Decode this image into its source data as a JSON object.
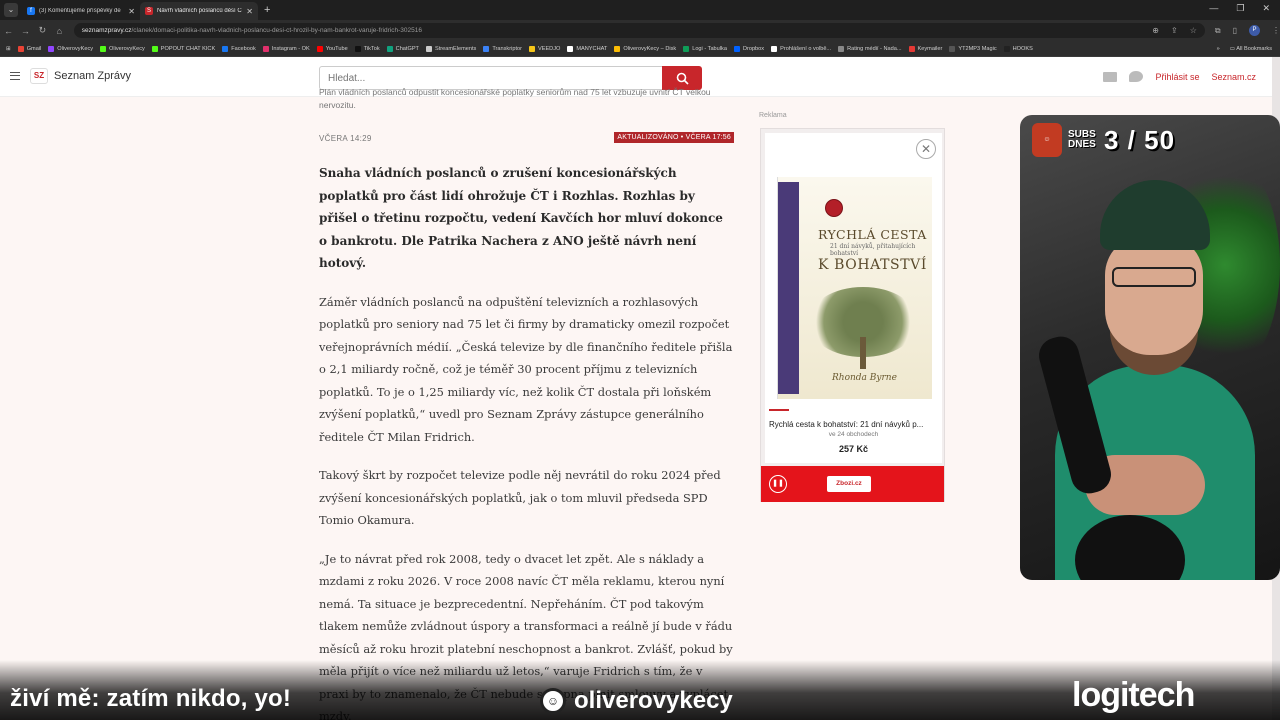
{
  "browser": {
    "tabs": [
      {
        "title": "(3) Komentujeme příspěvky de",
        "icon": "facebook-icon",
        "color": "#1877f2",
        "active": false
      },
      {
        "title": "Návrh vládních poslanců děsí Č",
        "icon": "sz-icon",
        "color": "#c8262b",
        "active": true
      }
    ],
    "url_domain": "seznamzpravy.cz",
    "url_path": "/clanek/domaci-politika-navrh-vladnich-poslancu-desi-ct-hrozil-by-nam-bankrot-varuje-fridrich-302516",
    "bookmarks": [
      {
        "label": "Gmail",
        "color": "#ea4335"
      },
      {
        "label": "OliverovyKecy",
        "color": "#9146ff"
      },
      {
        "label": "OliverovyKecy",
        "color": "#53fc18"
      },
      {
        "label": "POPOUT CHAT KICK",
        "color": "#53fc18"
      },
      {
        "label": "Facebook",
        "color": "#1877f2"
      },
      {
        "label": "Instagram - OK",
        "color": "#e1306c"
      },
      {
        "label": "YouTube",
        "color": "#ff0000"
      },
      {
        "label": "TikTok",
        "color": "#111111"
      },
      {
        "label": "ChatGPT",
        "color": "#10a37f"
      },
      {
        "label": "StreamElements",
        "color": "#cccccc"
      },
      {
        "label": "Transkriptor",
        "color": "#3b82f6"
      },
      {
        "label": "VEEDJO",
        "color": "#f5c518"
      },
      {
        "label": "MANYCHAT",
        "color": "#ffffff"
      },
      {
        "label": "OliverovyKecy – Disk",
        "color": "#fbbc04"
      },
      {
        "label": "Logi - Tabulka",
        "color": "#0f9d58"
      },
      {
        "label": "Dropbox",
        "color": "#0061ff"
      },
      {
        "label": "Prohlášení o volbě...",
        "color": "#ffffff"
      },
      {
        "label": "Rating médií - Nada...",
        "color": "#888888"
      },
      {
        "label": "Keymailer",
        "color": "#e53935"
      },
      {
        "label": "YT2MP3 Magic",
        "color": "#555555"
      },
      {
        "label": "HOOKS",
        "color": "#222222"
      }
    ],
    "all_bookmarks": "All Bookmarks",
    "profile_initial": "P"
  },
  "site": {
    "logo_mark": "SZ",
    "logo_text": "Seznam Zprávy",
    "search_placeholder": "Hledat...",
    "login": "Přihlásit se",
    "portal": "Seznam.cz",
    "accent": "#c8262b"
  },
  "article": {
    "caption": "Plán vládních poslanců odpustit koncesionářské poplatky seniorům nad 75 let vzbuzuje uvnitř ČT velkou nervozitu.",
    "date": "VČERA 14:29",
    "updated": "AKTUALIZOVÁNO • VČERA 17:56",
    "lead": "Snaha vládních poslanců o zrušení koncesionářských poplatků pro část lidí ohrožuje ČT i Rozhlas. Rozhlas by přišel o třetinu rozpočtu, vedení Kavčích hor mluví dokonce o bankrotu. Dle Patrika Nachera z ANO ještě návrh není hotový.",
    "paragraphs": [
      "Záměr vládních poslanců na odpuštění televizních a rozhlasových poplatků pro seniory nad 75 let či firmy by dramaticky omezil rozpočet veřejnoprávních médií. „Česká televize by dle finančního ředitele přišla o 2,1 miliardy ročně, což je téměř 30 procent příjmu z televizních poplatků. To je o 1,25 miliardy víc, než kolik ČT dostala při loňském zvýšení poplatků,“ uvedl pro Seznam Zprávy zástupce generálního ředitele ČT Milan Fridrich.",
      "Takový škrt by rozpočet televize podle něj nevrátil do roku 2024 před zvýšení koncesionářských poplatků, jak o tom mluvil předseda SPD Tomio Okamura.",
      "„Je to návrat před rok 2008, tedy o dvacet let zpět. Ale s náklady a mzdami z roku 2026. V roce 2008 navíc ČT měla reklamu, kterou nyní nemá. Ta situace je bezprecedentní. Nepřeháním. ČT pod takovým tlakem nemůže zvládnout úspory a transformaci a reálně jí bude v řádu měsíců až roku hrozit platební neschopnost a bankrot. Zvlášť, pokud by měla přijít o více než miliardu už letos,“ varuje Fridrich s tím, že v praxi by to znamenalo, že ČT nebude schopna plnit smlouvy a vyplácet mzdy."
    ]
  },
  "ad": {
    "label": "Reklama",
    "book_title_1": "RYCHLÁ CESTA",
    "book_subtitle": "21 dní návyků, přitahujících bohatství",
    "book_title_2": "K BOHATSTVÍ",
    "book_author": "Rhonda Byrne",
    "product": "Rychlá cesta k bohatství: 21 dní návyků p...",
    "shops": "ve 24 obchodech",
    "price": "257 Kč",
    "brand": "Zbozi.cz",
    "brand_color": "#e4141b"
  },
  "stream": {
    "subs_label": "SUBS DNES",
    "subs_count": "3 / 50",
    "ticker": "živí mě: zatím nikdo, yo!",
    "channel": "oliverovykecy",
    "sponsor": "logitech"
  }
}
